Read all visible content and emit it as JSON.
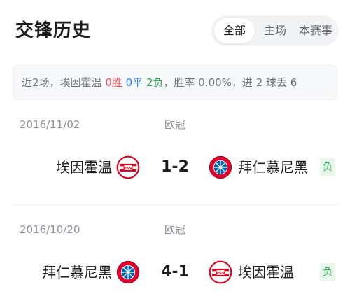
{
  "title": "交锋历史",
  "tabs": [
    {
      "label": "全部",
      "active": true
    },
    {
      "label": "主场",
      "active": false
    },
    {
      "label": "本赛事",
      "active": false
    }
  ],
  "summary": {
    "prefix": "近2场，埃因霍温 ",
    "wins": "0胜",
    "draws": "0平",
    "losses": "2负",
    "suffix": "，胜率 0.00%，进 2 球丢 6"
  },
  "matches": [
    {
      "date": "2016/11/02",
      "competition": "欧冠",
      "home": {
        "name": "埃因霍温",
        "logo": "psv-logo"
      },
      "score": "1-2",
      "away": {
        "name": "拜仁慕尼黑",
        "logo": "bayern-logo"
      },
      "result": "负"
    },
    {
      "date": "2016/10/20",
      "competition": "欧冠",
      "home": {
        "name": "拜仁慕尼黑",
        "logo": "bayern-logo"
      },
      "score": "4-1",
      "away": {
        "name": "埃因霍温",
        "logo": "psv-logo"
      },
      "result": "负"
    }
  ],
  "colors": {
    "win": "#e94b4b",
    "draw": "#2f7cf6",
    "loss": "#2da44e",
    "psv_red": "#e2001a",
    "bayern_red": "#dc052d",
    "bayern_blue": "#0066b2"
  }
}
